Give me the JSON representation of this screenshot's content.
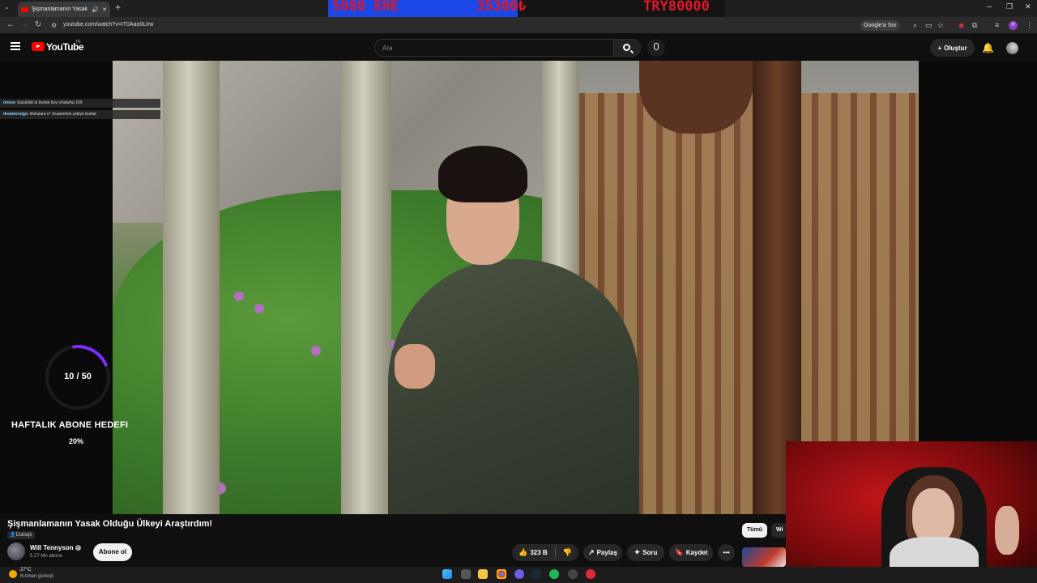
{
  "browser": {
    "tab_title": "Şişmanlamanın Yasak Oldu...",
    "tab_audio_icon": "speaker-icon",
    "url": "youtube.com/watch?v=IT0Aao0LIrw",
    "google_sor_label": "Google'a Sor",
    "profile_initial": "H"
  },
  "stream_overlay": {
    "left_text": "5080 EHE",
    "mid_text": "35300₺",
    "right_text": "TRY80000",
    "accent_color": "#1b47e6",
    "text_color": "#e01828"
  },
  "youtube_header": {
    "logo_text": "YouTube",
    "country_code": "TR",
    "search_placeholder": "Ara",
    "create_label": "Oluştur"
  },
  "chat": [
    {
      "name": "oneue",
      "message": "küçüklük la bunlar boy ortalama 169"
    },
    {
      "name": "dreamerslgo",
      "message": "kilolulara o* muamelesi çekiyo bunlar"
    }
  ],
  "goal_widget": {
    "count_text": "10 / 50",
    "title": "HAFTALIK ABONE HEDEFI",
    "percent_text": "20%",
    "progress": 0.2,
    "accent_color": "#7d2cff"
  },
  "video": {
    "title": "Şişmanlamanın Yasak Olduğu Ülkeyi Araştırdım!",
    "badge": "Dublajlı",
    "channel_name": "Will Tennyson",
    "channel_subs": "5,27 Mn abone",
    "subscribe_label": "Abone ol"
  },
  "actions": {
    "like_count": "323 B",
    "share_label": "Paylaş",
    "ask_label": "Soru",
    "save_label": "Kaydet",
    "more_label": "•••"
  },
  "chips": {
    "all_label": "Tümü",
    "more_label": "Wi"
  },
  "taskbar": {
    "temp": "27°C",
    "weather": "Kısmen güneşli"
  }
}
